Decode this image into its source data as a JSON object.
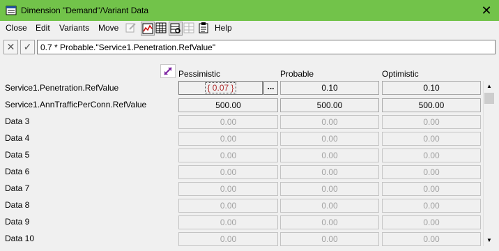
{
  "window": {
    "title": "Dimension \"Demand\"/Variant Data",
    "close_glyph": "✕"
  },
  "menu": {
    "items": [
      "Close",
      "Edit",
      "Variants",
      "Move",
      "Help"
    ]
  },
  "toolbar": {
    "icons": [
      "edit-note-icon",
      "chart-icon",
      "table-grid-icon",
      "table-search-icon",
      "table-filter-icon",
      "clipboard-icon"
    ]
  },
  "formula_bar": {
    "cancel_glyph": "✕",
    "confirm_glyph": "✓",
    "value": "0.7 * Probable.\"Service1.Penetration.RefValue\""
  },
  "grid": {
    "columns": [
      "Pessimistic",
      "Probable",
      "Optimistic"
    ],
    "ellipsis": "...",
    "rows": [
      {
        "label": "Service1.Penetration.RefValue",
        "values": [
          "{ 0.07 }",
          "0.10",
          "0.10"
        ]
      },
      {
        "label": "Service1.AnnTrafficPerConn.RefValue",
        "values": [
          "500.00",
          "500.00",
          "500.00"
        ]
      },
      {
        "label": "Data 3",
        "values": [
          "0.00",
          "0.00",
          "0.00"
        ]
      },
      {
        "label": "Data 4",
        "values": [
          "0.00",
          "0.00",
          "0.00"
        ]
      },
      {
        "label": "Data 5",
        "values": [
          "0.00",
          "0.00",
          "0.00"
        ]
      },
      {
        "label": "Data 6",
        "values": [
          "0.00",
          "0.00",
          "0.00"
        ]
      },
      {
        "label": "Data 7",
        "values": [
          "0.00",
          "0.00",
          "0.00"
        ]
      },
      {
        "label": "Data 8",
        "values": [
          "0.00",
          "0.00",
          "0.00"
        ]
      },
      {
        "label": "Data 9",
        "values": [
          "0.00",
          "0.00",
          "0.00"
        ]
      },
      {
        "label": "Data 10",
        "values": [
          "0.00",
          "0.00",
          "0.00"
        ]
      }
    ]
  },
  "colors": {
    "titlebar": "#72c34a",
    "active_value": "#b03030",
    "disabled_text": "#a0a0a0"
  }
}
